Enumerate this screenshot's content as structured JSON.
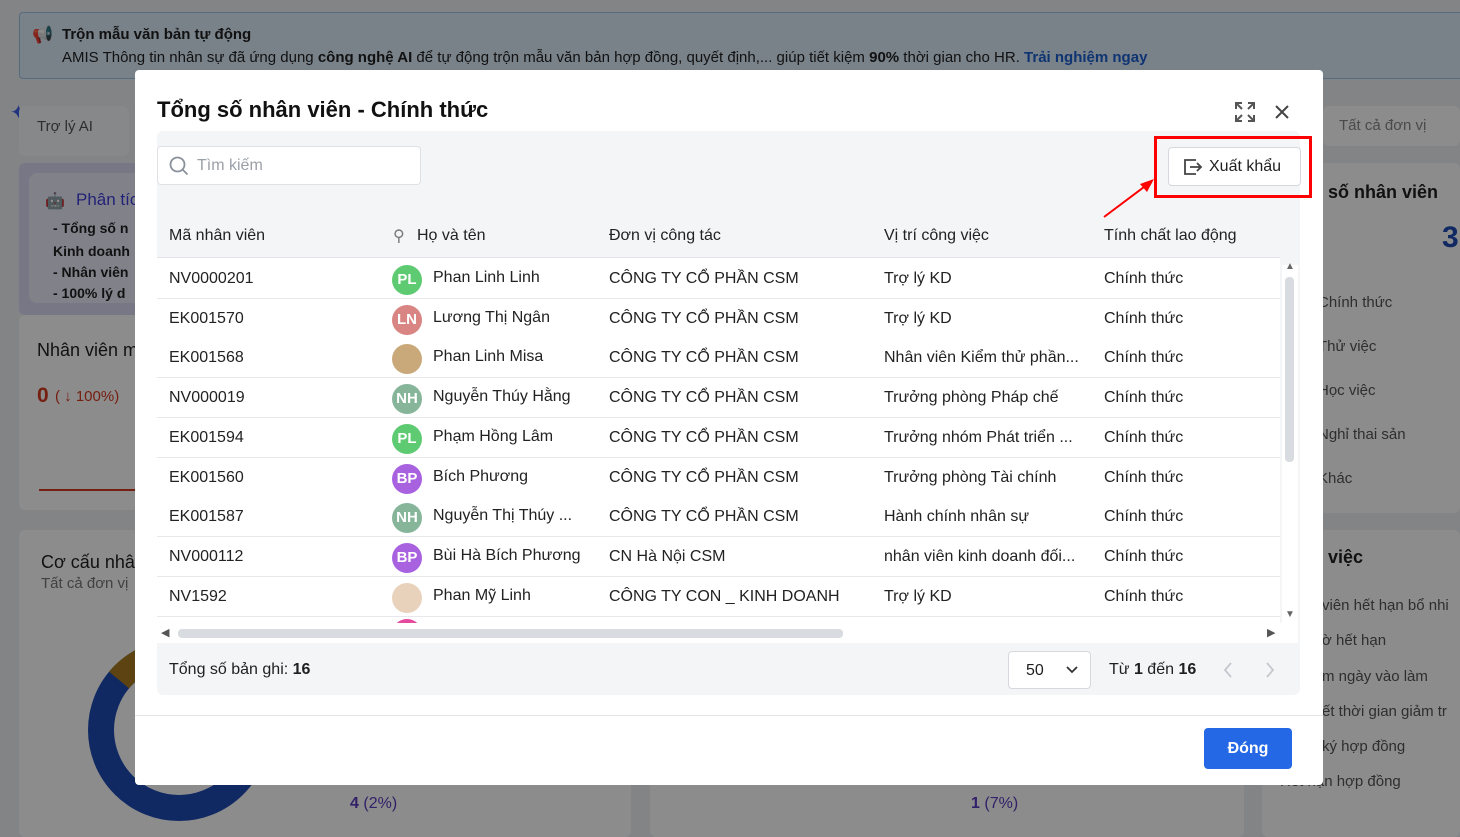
{
  "banner": {
    "title": "Trộn mẫu văn bản tự động",
    "text_1": "AMIS Thông tin nhân sự đã ứng dụng ",
    "bold_1": "công nghệ AI",
    "text_2": " để tự động trộn mẫu văn bản hợp đồng, quyết định,... giúp tiết kiệm ",
    "bold_2": "90%",
    "text_3": " thời gian cho HR. ",
    "link": "Trải nghiệm ngay"
  },
  "background": {
    "ai_tab": "Trợ lý AI",
    "unit_filter": "Tất cả đơn vị",
    "analysis_title": "Phân tíc",
    "analysis_lines": [
      "- Tổng số n",
      "Kinh doanh",
      "- Nhân viên",
      "- 100% lý d"
    ],
    "new_employees": "Nhân viên m",
    "new_value": "0",
    "new_change": "( ↓ 100%)",
    "structure_title": "Cơ cấu nhâ",
    "structure_sub": "Tất cả đơn vị",
    "legend_value": "4",
    "legend_pct": "(2%)",
    "legend_value2": "1",
    "legend_pct2": "(7%)",
    "total_title": "số nhân viên",
    "total_value": "3",
    "type_list": [
      "Chính thức",
      "Thử việc",
      "Học việc",
      "Nghỉ thai sản",
      "Khác"
    ],
    "work_title": "việc",
    "work_list": [
      "viên hết hạn bổ nhi",
      "ờ hết hạn",
      "m ngày vào làm",
      "ết thời gian giảm tr",
      "ký hợp đồng",
      "Hết hạn hợp đồng"
    ]
  },
  "modal": {
    "title": "Tổng số nhân viên - Chính thức",
    "search_placeholder": "Tìm kiếm",
    "export_label": "Xuất khẩu",
    "columns": [
      "Mã nhân viên",
      "Họ và tên",
      "Đơn vị công tác",
      "Vị trí công việc",
      "Tính chất lao động"
    ],
    "rows": [
      {
        "code": "NV0000201",
        "initials": "PL",
        "color": "#5ecb72",
        "name": "Phan Linh Linh",
        "unit": "CÔNG TY CỔ PHẦN CSM",
        "position": "Trợ lý KD",
        "type": "Chính thức"
      },
      {
        "code": "EK001570",
        "initials": "LN",
        "color": "#d98584",
        "name": "Lương Thị Ngân",
        "unit": "CÔNG TY CỔ PHẦN CSM",
        "position": "Trợ lý KD",
        "type": "Chính thức"
      },
      {
        "code": "EK001568",
        "initials": "",
        "color": "#c9a97a",
        "name": "Phan Linh Misa",
        "unit": "CÔNG TY CỔ PHẦN CSM",
        "position": "Nhân viên Kiểm thử phần...",
        "type": "Chính thức"
      },
      {
        "code": "NV000019",
        "initials": "NH",
        "color": "#86b59a",
        "name": "Nguyễn Thúy Hằng",
        "unit": "CÔNG TY CỔ PHẦN CSM",
        "position": "Trưởng phòng Pháp chế",
        "type": "Chính thức"
      },
      {
        "code": "EK001594",
        "initials": "PL",
        "color": "#5ecb72",
        "name": "Phạm Hồng Lâm",
        "unit": "CÔNG TY CỔ PHẦN CSM",
        "position": "Trưởng nhóm Phát triển ...",
        "type": "Chính thức"
      },
      {
        "code": "EK001560",
        "initials": "BP",
        "color": "#a862e0",
        "name": "Bích Phương",
        "unit": "CÔNG TY CỔ PHẦN CSM",
        "position": "Trưởng phòng Tài chính",
        "type": "Chính thức"
      },
      {
        "code": "EK001587",
        "initials": "NH",
        "color": "#86b59a",
        "name": "Nguyễn Thị Thúy ...",
        "unit": "CÔNG TY CỔ PHẦN CSM",
        "position": "Hành chính nhân sự",
        "type": "Chính thức"
      },
      {
        "code": "NV000112",
        "initials": "BP",
        "color": "#a862e0",
        "name": "Bùi Hà Bích Phương",
        "unit": "CN Hà Nội CSM",
        "position": "nhân viên kinh doanh đối...",
        "type": "Chính thức"
      },
      {
        "code": "NV1592",
        "initials": "",
        "color": "#e8d2bc",
        "name": "Phan Mỹ Linh",
        "unit": "CÔNG TY CON _ KINH DOANH",
        "position": "Trợ lý KD",
        "type": "Chính thức"
      }
    ],
    "total_label": "Tổng số bản ghi:",
    "total_count": "16",
    "page_size": "50",
    "range_prefix": "Từ",
    "range_from": "1",
    "range_mid": "đến",
    "range_to": "16",
    "close_label": "Đóng"
  }
}
